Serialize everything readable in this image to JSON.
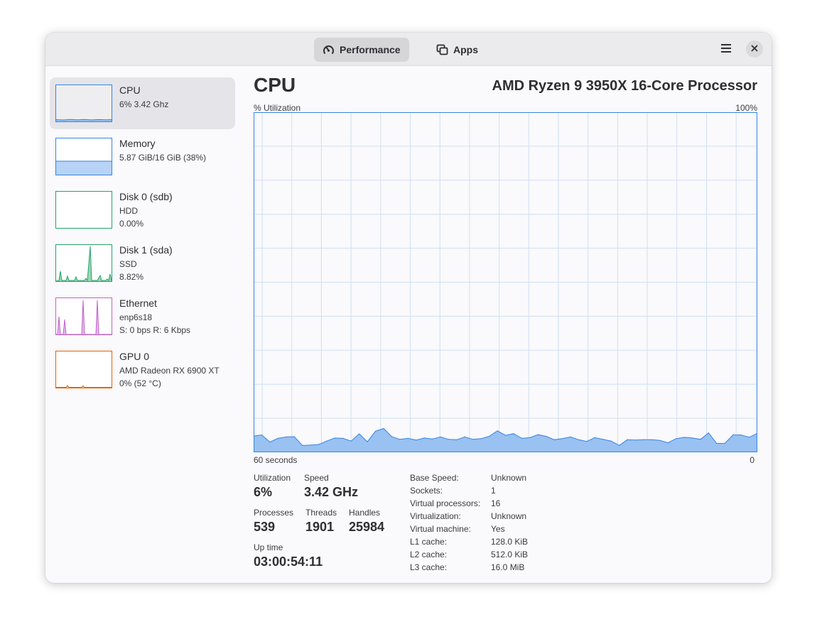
{
  "header": {
    "tabs": [
      {
        "label": "Performance",
        "icon": "gauge-icon",
        "active": true
      },
      {
        "label": "Apps",
        "icon": "windows-icon",
        "active": false
      }
    ],
    "menu_icon": "hamburger-menu-icon",
    "close_icon": "close-icon"
  },
  "sidebar": {
    "items": [
      {
        "title": "CPU",
        "line1": "6% 3.42 Ghz",
        "line2": "",
        "color": "#3584e4",
        "selected": true
      },
      {
        "title": "Memory",
        "line1": "5.87 GiB/16 GiB (38%)",
        "line2": "",
        "color": "#3584e4",
        "selected": false
      },
      {
        "title": "Disk 0 (sdb)",
        "line1": "HDD",
        "line2": "0.00%",
        "color": "#26a269",
        "selected": false
      },
      {
        "title": "Disk 1 (sda)",
        "line1": "SSD",
        "line2": "8.82%",
        "color": "#26a269",
        "selected": false
      },
      {
        "title": "Ethernet",
        "line1": "enp6s18",
        "line2": "S: 0 bps R: 6 Kbps",
        "color": "#c061cb",
        "selected": false
      },
      {
        "title": "GPU 0",
        "line1": "AMD Radeon RX 6900 XT",
        "line2": "0% (52 °C)",
        "color": "#e66100",
        "selected": false
      }
    ]
  },
  "main": {
    "title": "CPU",
    "model": "AMD Ryzen 9 3950X 16-Core Processor",
    "graph": {
      "y_label": "% Utilization",
      "y_max_label": "100%",
      "x_left_label": "60 seconds",
      "x_right_label": "0",
      "line_color": "#3584e4",
      "fill_color": "#99c1f1",
      "grid_color": "#cfe0f5"
    },
    "stats": {
      "utilization_label": "Utilization",
      "utilization": "6%",
      "speed_label": "Speed",
      "speed": "3.42 GHz",
      "processes_label": "Processes",
      "processes": "539",
      "threads_label": "Threads",
      "threads": "1901",
      "handles_label": "Handles",
      "handles": "25984",
      "uptime_label": "Up time",
      "uptime": "03:00:54:11"
    },
    "specs": [
      {
        "key": "Base Speed:",
        "value": "Unknown"
      },
      {
        "key": "Sockets:",
        "value": "1"
      },
      {
        "key": "Virtual processors:",
        "value": "16"
      },
      {
        "key": "Virtualization:",
        "value": "Unknown"
      },
      {
        "key": "Virtual machine:",
        "value": "Yes"
      },
      {
        "key": "L1 cache:",
        "value": "128.0 KiB"
      },
      {
        "key": "L2 cache:",
        "value": "512.0 KiB"
      },
      {
        "key": "L3 cache:",
        "value": "16.0 MiB"
      }
    ]
  },
  "chart_data": {
    "type": "area",
    "title": "",
    "ylabel": "% Utilization",
    "xlabel": "",
    "ylim": [
      0,
      100
    ],
    "xlim": [
      60,
      0
    ],
    "x_tick_labels": [
      "60 seconds",
      "0"
    ],
    "grid": true,
    "series": [
      {
        "values": [
          4.8,
          5.1,
          3.0,
          4.1,
          4.5,
          4.6,
          2.0,
          2.1,
          2.3,
          3.3,
          4.2,
          4.1,
          3.3,
          5.4,
          3.1,
          6.2,
          7.0,
          4.6,
          3.8,
          4.1,
          3.6,
          4.2,
          3.9,
          4.5,
          3.8,
          3.7,
          4.5,
          3.8,
          4.0,
          4.7,
          6.3,
          5.0,
          5.5,
          4.1,
          4.3,
          5.2,
          4.7,
          3.7,
          4.0,
          4.5,
          3.7,
          3.2,
          4.3,
          3.8,
          3.3,
          2.0,
          3.7,
          3.6,
          3.7,
          3.7,
          3.5,
          2.8,
          4.0,
          4.4,
          4.2,
          3.8,
          5.7,
          2.6,
          2.6,
          5.1,
          5.1,
          4.4,
          5.6
        ]
      }
    ]
  }
}
